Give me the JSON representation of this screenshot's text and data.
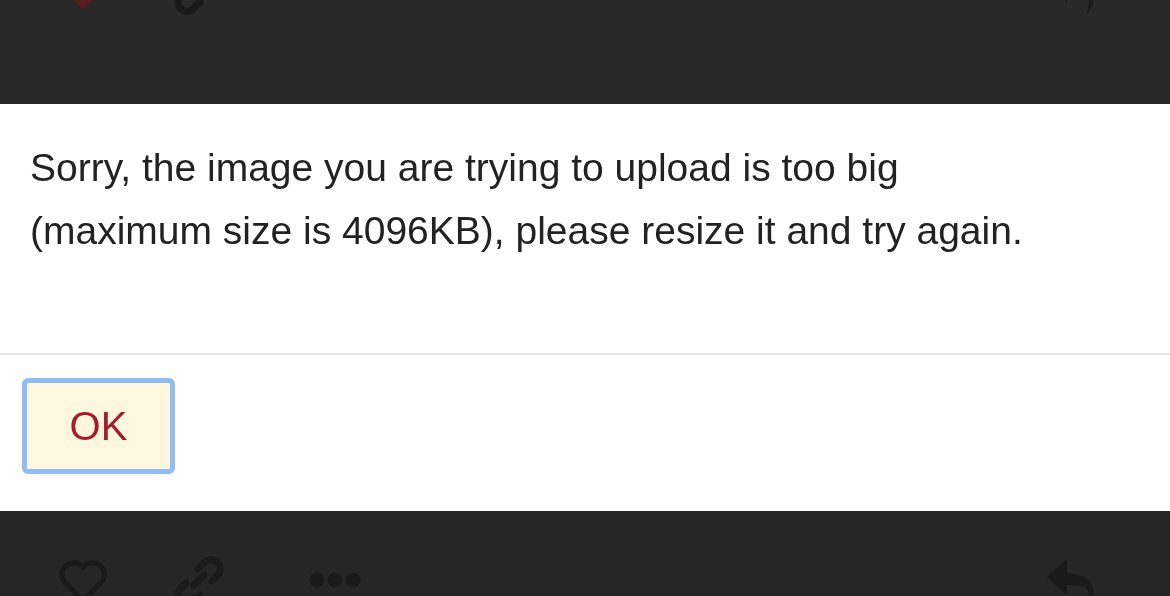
{
  "toolbars": [
    {
      "liked": true
    },
    {
      "liked": false
    }
  ],
  "dialog": {
    "message": "Sorry, the image you are trying to upload is too big (maximum size is 4096KB), please resize it and try again.",
    "button": {
      "label": "OK",
      "focused": true
    }
  }
}
